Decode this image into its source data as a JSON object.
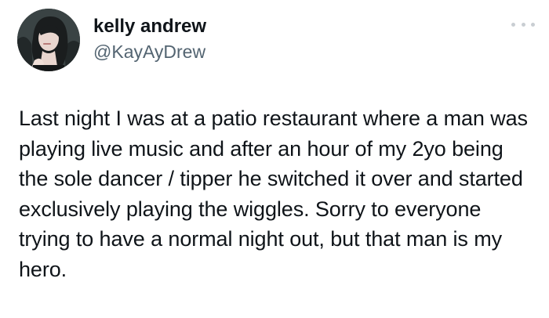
{
  "tweet": {
    "author": {
      "display_name": "kelly andrew",
      "handle": "@KayAyDrew",
      "avatar_icon": "profile-photo"
    },
    "menu_icon": "more-options-icon",
    "text": "Last night I was at a patio restaurant where a man was playing live music and after an hour of my 2yo being the sole dancer / tipper he switched it over and started exclusively playing the wiggles. Sorry to everyone trying to have a normal night out, but that man is my hero."
  },
  "colors": {
    "text_primary": "#0f1419",
    "text_secondary": "#536471",
    "background": "#ffffff"
  }
}
